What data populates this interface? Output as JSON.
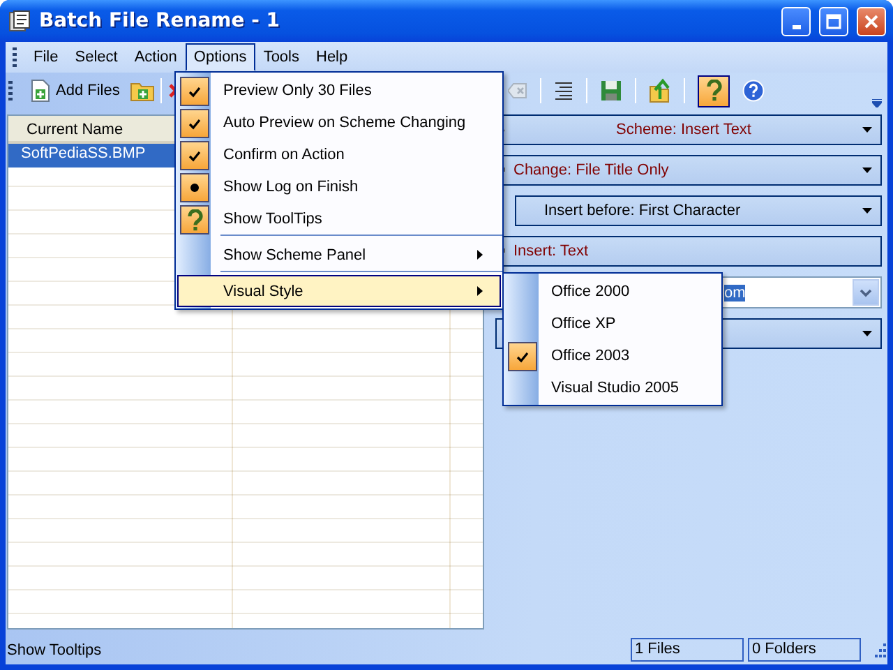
{
  "window": {
    "title": "Batch File Rename - 1"
  },
  "menu_bar": [
    {
      "label": "File",
      "selected": false
    },
    {
      "label": "Select",
      "selected": false
    },
    {
      "label": "Action",
      "selected": false
    },
    {
      "label": "Options",
      "selected": true
    },
    {
      "label": "Tools",
      "selected": false
    },
    {
      "label": "Help",
      "selected": false
    }
  ],
  "toolbar": {
    "add_files": "Add Files"
  },
  "file_list": {
    "columns": [
      "Current Name"
    ],
    "rows": [
      {
        "cells": [
          "SoftPediaSS.BMP"
        ],
        "selected": true
      }
    ]
  },
  "scheme_panel": {
    "rows": [
      {
        "kind": "header",
        "label": "Scheme: Insert Text"
      },
      {
        "kind": "section",
        "label": "Change: File Title Only"
      },
      {
        "kind": "option",
        "label": "Insert before: First Character"
      },
      {
        "kind": "title",
        "label": "Insert: Text"
      },
      {
        "kind": "input",
        "value": "om"
      },
      {
        "kind": "dropdown"
      }
    ]
  },
  "options_menu": {
    "items": [
      {
        "kind": "check",
        "label": "Preview Only 30 Files",
        "checked": true
      },
      {
        "kind": "check",
        "label": "Auto Preview on Scheme Changing",
        "checked": true
      },
      {
        "kind": "check",
        "label": "Confirm on Action",
        "checked": true
      },
      {
        "kind": "radio",
        "label": "Show Log on Finish",
        "checked": true
      },
      {
        "kind": "help",
        "label": "Show ToolTips",
        "checked": true
      },
      {
        "kind": "separator"
      },
      {
        "kind": "submenu",
        "label": "Show Scheme Panel",
        "selected": false
      },
      {
        "kind": "separator"
      },
      {
        "kind": "submenu",
        "label": "Visual Style",
        "selected": true
      }
    ]
  },
  "visual_style_menu": {
    "items": [
      {
        "label": "Office 2000",
        "checked": false
      },
      {
        "label": "Office XP",
        "checked": false
      },
      {
        "label": "Office 2003",
        "checked": true
      },
      {
        "label": "Visual Studio 2005",
        "checked": false
      }
    ]
  },
  "status_bar": {
    "message": "Show Tooltips",
    "files": "1 Files",
    "folders": "0 Folders"
  }
}
